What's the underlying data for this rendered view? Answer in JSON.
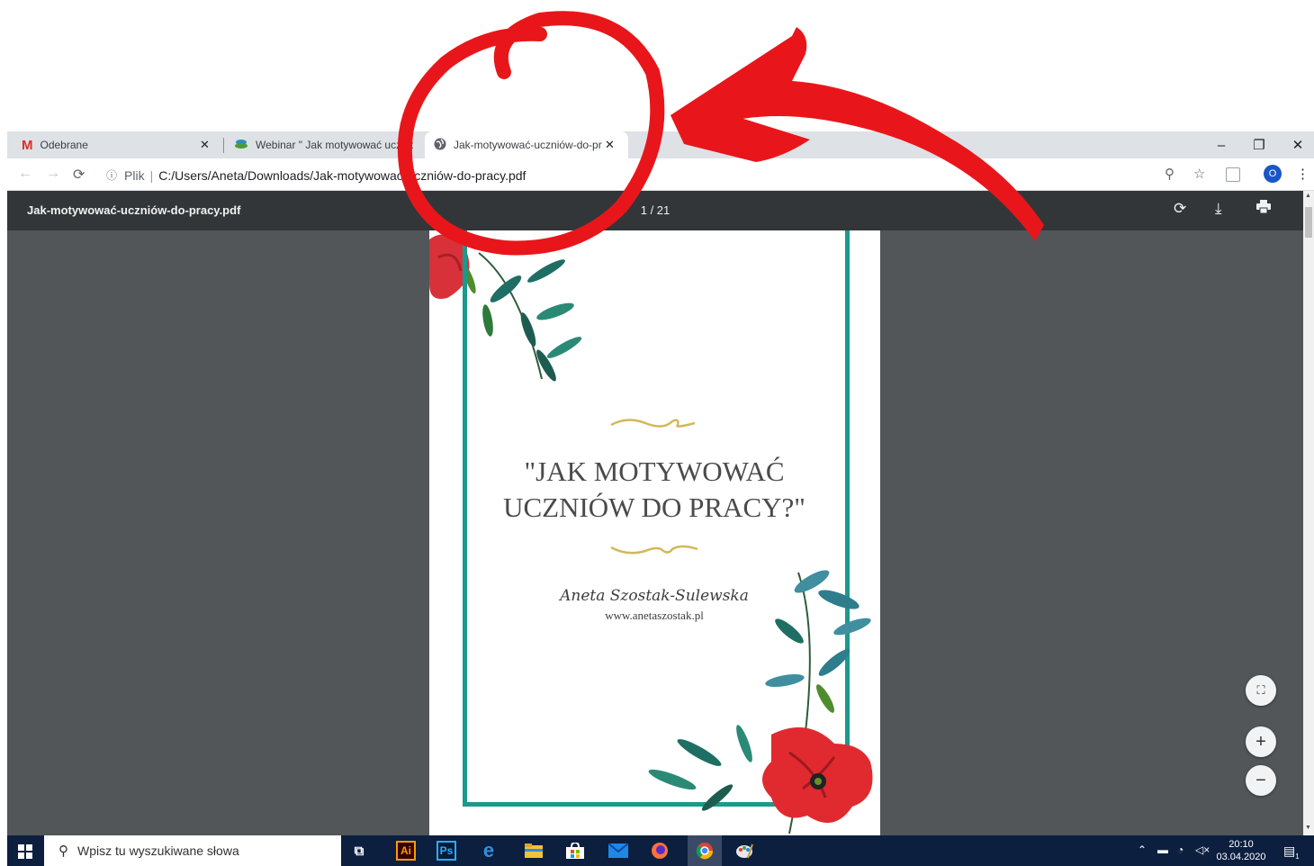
{
  "tabs": [
    {
      "label": "Odebrane",
      "icon": "gmail-icon"
    },
    {
      "label": "Webinar \" Jak motywować ucznic",
      "icon": "webinar-icon"
    },
    {
      "label": "Jak-motywować-uczniów-do-pra",
      "icon": "globe-icon",
      "active": true
    }
  ],
  "address_bar": {
    "scheme_label": "Plik",
    "separator": "|",
    "url": "C:/Users/Aneta/Downloads/Jak-motywować-uczniów-do-pracy.pdf"
  },
  "pdf_viewer": {
    "filename": "Jak-motywować-uczniów-do-pracy.pdf",
    "page_indicator": "1 / 21"
  },
  "document": {
    "title_line1": "\"JAK MOTYWOWAĆ",
    "title_line2": "UCZNIÓW DO PRACY?\"",
    "author": "Aneta Szostak-Sulewska",
    "website": "www.anetaszostak.pl",
    "accent_color": "#1a9a8c",
    "gold_color": "#d4b85a"
  },
  "profile": {
    "initial": "O"
  },
  "taskbar": {
    "search_placeholder": "Wpisz tu wyszukiwane słowa",
    "apps": [
      "task-view-icon",
      "illustrator-icon",
      "photoshop-icon",
      "edge-icon",
      "file-explorer-icon",
      "store-icon",
      "mail-icon",
      "firefox-icon",
      "chrome-icon",
      "paint-icon"
    ],
    "ai_label": "Ai",
    "ps_label": "Ps",
    "time": "20:10",
    "date": "03.04.2020",
    "notification_count": "1"
  },
  "annotation": {
    "color": "#e8161a",
    "shapes": [
      "hand-drawn-circle",
      "curved-arrow"
    ]
  }
}
